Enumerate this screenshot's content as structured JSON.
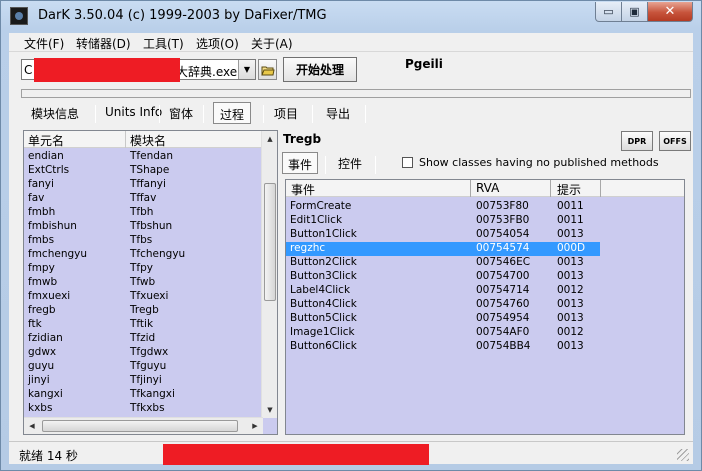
{
  "window": {
    "title": "DarK 3.50.04 (c) 1999-2003 by DaFixer/TMG",
    "min_glyph": "▭",
    "max_glyph": "▣",
    "close_glyph": "✕"
  },
  "menu": [
    "文件(F)",
    "转储器(D)",
    "工具(T)",
    "选项(O)",
    "关于(A)"
  ],
  "toolbar": {
    "file_prefix": "C",
    "file_suffix": "大辞典.exe",
    "start_label": "开始处理",
    "company": "Pgeili"
  },
  "tabs": [
    "模块信息",
    "Units Info",
    "窗体",
    "过程",
    "项目",
    "导出"
  ],
  "active_tab_index": 3,
  "left_list": {
    "columns": [
      "单元名",
      "模块名"
    ],
    "rows": [
      [
        "endian",
        "Tfendan"
      ],
      [
        "ExtCtrls",
        "TShape"
      ],
      [
        "fanyi",
        "Tffanyi"
      ],
      [
        "fav",
        "Tffav"
      ],
      [
        "fmbh",
        "Tfbh"
      ],
      [
        "fmbishun",
        "Tfbshun"
      ],
      [
        "fmbs",
        "Tfbs"
      ],
      [
        "fmchengyu",
        "Tfchengyu"
      ],
      [
        "fmpy",
        "Tfpy"
      ],
      [
        "fmwb",
        "Tfwb"
      ],
      [
        "fmxuexi",
        "Tfxuexi"
      ],
      [
        "fregb",
        "Tregb"
      ],
      [
        "ftk",
        "Tftik"
      ],
      [
        "fzidian",
        "Tfzid"
      ],
      [
        "gdwx",
        "Tfgdwx"
      ],
      [
        "guyu",
        "Tfguyu"
      ],
      [
        "jinyi",
        "Tfjinyi"
      ],
      [
        "kangxi",
        "Tfkangxi"
      ],
      [
        "kxbs",
        "Tfkxbs"
      ]
    ]
  },
  "right_panel": {
    "title": "Tregb",
    "dpr_label": "DPR",
    "offs_label": "OFFS",
    "subtabs": [
      "事件",
      "控件"
    ],
    "checkbox_label": "Show classes having no published methods",
    "checkbox_checked": false,
    "columns": [
      "事件",
      "RVA",
      "提示"
    ],
    "selected_index": 3,
    "rows": [
      [
        "FormCreate",
        "00753F80",
        "0011"
      ],
      [
        "Edit1Click",
        "00753FB0",
        "0011"
      ],
      [
        "Button1Click",
        "00754054",
        "0013"
      ],
      [
        "regzhc",
        "00754574",
        "000D"
      ],
      [
        "Button2Click",
        "007546EC",
        "0013"
      ],
      [
        "Button3Click",
        "00754700",
        "0013"
      ],
      [
        "Label4Click",
        "00754714",
        "0012"
      ],
      [
        "Button4Click",
        "00754760",
        "0013"
      ],
      [
        "Button5Click",
        "00754954",
        "0013"
      ],
      [
        "Image1Click",
        "00754AF0",
        "0012"
      ],
      [
        "Button6Click",
        "00754BB4",
        "0013"
      ]
    ]
  },
  "status": {
    "text": "就绪 14 秒"
  },
  "colors": {
    "list_bg": "#cbcbef",
    "selection": "#3399ff",
    "redaction": "#ee1c24"
  }
}
